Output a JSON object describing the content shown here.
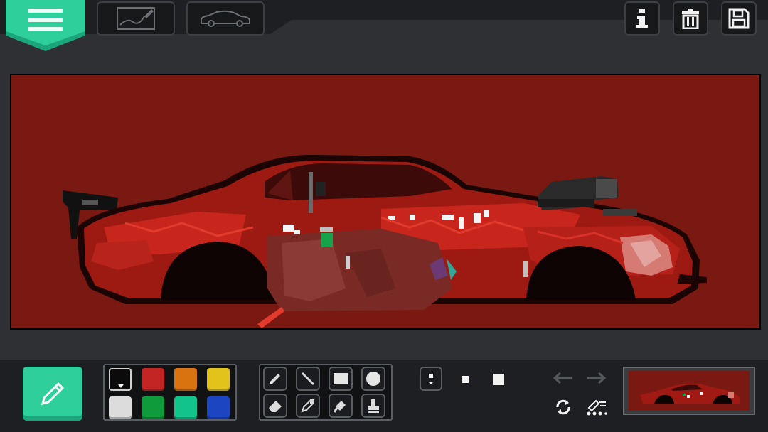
{
  "app": {
    "colors": {
      "accent": "#2ecf9a",
      "canvas_bg": "#7a1912",
      "toolbar_bg": "#1d1f22"
    }
  },
  "top_bar": {
    "menu_icon": "hamburger-icon",
    "tabs": [
      {
        "icon": "sketch-image-icon",
        "selected": false
      },
      {
        "icon": "car-outline-icon",
        "selected": false
      }
    ],
    "right_buttons": [
      {
        "icon": "info-icon"
      },
      {
        "icon": "trash-icon"
      },
      {
        "icon": "save-icon"
      }
    ]
  },
  "palette": {
    "selected_index": 0,
    "colors": [
      "#0b0b0b",
      "#c32424",
      "#d9730f",
      "#e2c31c",
      "#dcdcdc",
      "#0f9a3c",
      "#12c48c",
      "#1c45c2"
    ]
  },
  "tools": [
    {
      "icon": "pencil-icon",
      "selected": true
    },
    {
      "icon": "line-icon",
      "selected": false
    },
    {
      "icon": "rectangle-icon",
      "selected": false
    },
    {
      "icon": "circle-icon",
      "selected": false
    },
    {
      "icon": "eraser-icon",
      "selected": false
    },
    {
      "icon": "eyedropper-icon",
      "selected": false
    },
    {
      "icon": "fill-bucket-icon",
      "selected": false
    },
    {
      "icon": "stamp-icon",
      "selected": false
    }
  ],
  "brush_sizes": [
    {
      "icon": "brush-size-small-icon",
      "selected": true
    },
    {
      "icon": "brush-size-medium-icon",
      "selected": false
    },
    {
      "icon": "brush-size-large-icon",
      "selected": false
    }
  ],
  "actions": [
    {
      "icon": "undo-icon",
      "enabled": false
    },
    {
      "icon": "redo-icon",
      "enabled": false
    },
    {
      "icon": "refresh-icon",
      "enabled": true
    },
    {
      "icon": "layers-icon",
      "enabled": true
    }
  ]
}
